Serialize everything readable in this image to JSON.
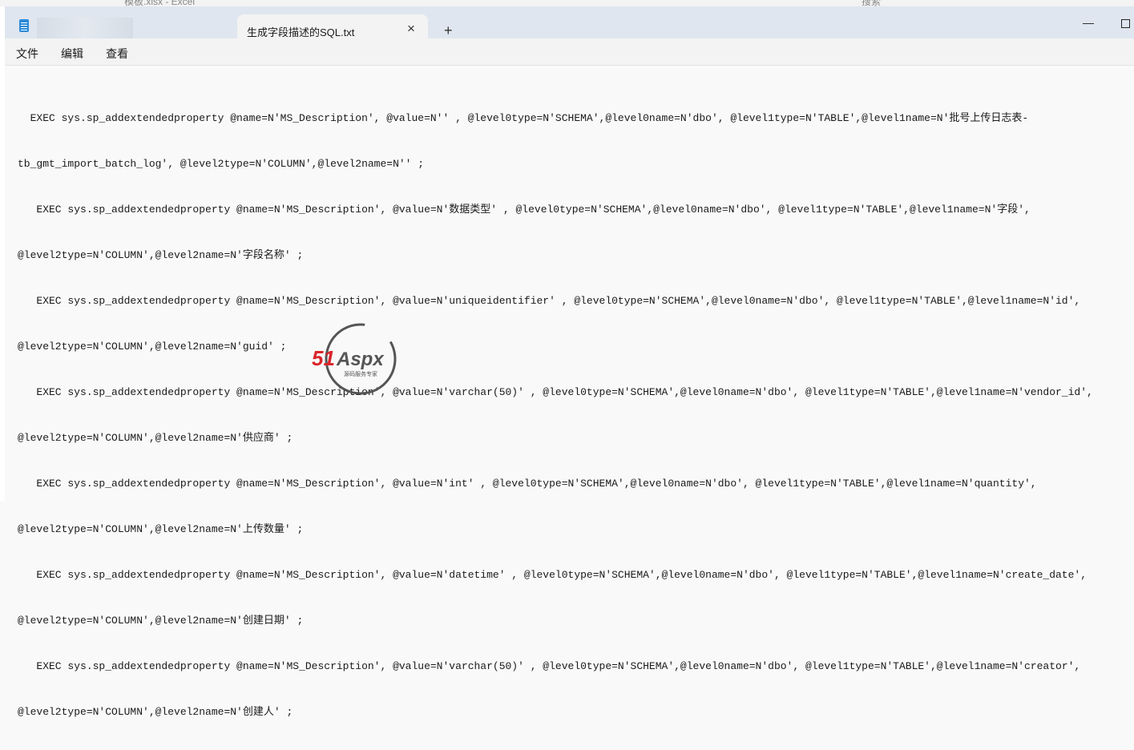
{
  "background_app": {
    "title": "模板.xlsx - Excel",
    "search": "搜索"
  },
  "tab": {
    "title": "生成字段描述的SQL.txt",
    "close": "×",
    "new_tab": "+"
  },
  "window_controls": {
    "minimize": "—"
  },
  "menu": [
    "文件",
    "编辑",
    "查看"
  ],
  "content_lines": [
    "  EXEC sys.sp_addextendedproperty @name=N'MS_Description', @value=N'' , @level0type=N'SCHEMA',@level0name=N'dbo', @level1type=N'TABLE',@level1name=N'批号上传日志表-",
    "tb_gmt_import_batch_log', @level2type=N'COLUMN',@level2name=N'' ;",
    "   EXEC sys.sp_addextendedproperty @name=N'MS_Description', @value=N'数据类型' , @level0type=N'SCHEMA',@level0name=N'dbo', @level1type=N'TABLE',@level1name=N'字段',",
    "@level2type=N'COLUMN',@level2name=N'字段名称' ;",
    "   EXEC sys.sp_addextendedproperty @name=N'MS_Description', @value=N'uniqueidentifier' , @level0type=N'SCHEMA',@level0name=N'dbo', @level1type=N'TABLE',@level1name=N'id',",
    "@level2type=N'COLUMN',@level2name=N'guid' ;",
    "   EXEC sys.sp_addextendedproperty @name=N'MS_Description', @value=N'varchar(50)' , @level0type=N'SCHEMA',@level0name=N'dbo', @level1type=N'TABLE',@level1name=N'vendor_id',",
    "@level2type=N'COLUMN',@level2name=N'供应商' ;",
    "   EXEC sys.sp_addextendedproperty @name=N'MS_Description', @value=N'int' , @level0type=N'SCHEMA',@level0name=N'dbo', @level1type=N'TABLE',@level1name=N'quantity',",
    "@level2type=N'COLUMN',@level2name=N'上传数量' ;",
    "   EXEC sys.sp_addextendedproperty @name=N'MS_Description', @value=N'datetime' , @level0type=N'SCHEMA',@level0name=N'dbo', @level1type=N'TABLE',@level1name=N'create_date',",
    "@level2type=N'COLUMN',@level2name=N'创建日期' ;",
    "   EXEC sys.sp_addextendedproperty @name=N'MS_Description', @value=N'varchar(50)' , @level0type=N'SCHEMA',@level0name=N'dbo', @level1type=N'TABLE',@level1name=N'creator',",
    "@level2type=N'COLUMN',@level2name=N'创建人' ;"
  ],
  "watermark": {
    "brand": "51Aspx",
    "tagline": "源码服务专家",
    "colors": {
      "red": "#d9262b",
      "green": "#3aa935",
      "ring": "#555555"
    }
  }
}
